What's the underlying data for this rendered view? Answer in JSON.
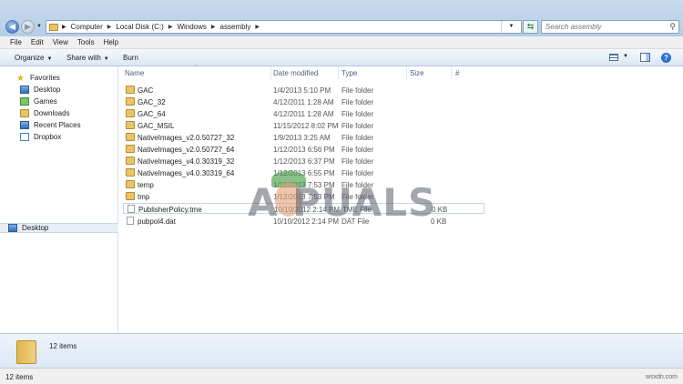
{
  "address": {
    "breadcrumbs": [
      "Computer",
      "Local Disk (C:)",
      "Windows",
      "assembly"
    ]
  },
  "search": {
    "placeholder": "Search assembly"
  },
  "menu": [
    "File",
    "Edit",
    "View",
    "Tools",
    "Help"
  ],
  "toolbar": {
    "organize": "Organize",
    "share": "Share with",
    "burn": "Burn"
  },
  "sidebar": {
    "favorites": "Favorites",
    "items": [
      "Desktop",
      "Games",
      "Downloads",
      "Recent Places",
      "Dropbox"
    ],
    "desktop_root": "Desktop"
  },
  "columns": {
    "name": "Name",
    "date": "Date modified",
    "type": "Type",
    "size": "Size",
    "extra": "#"
  },
  "files": [
    {
      "name": "GAC",
      "date": "1/4/2013 5:10 PM",
      "type": "File folder",
      "size": "",
      "icon": "folder"
    },
    {
      "name": "GAC_32",
      "date": "4/12/2011 1:28 AM",
      "type": "File folder",
      "size": "",
      "icon": "folder"
    },
    {
      "name": "GAC_64",
      "date": "4/12/2011 1:28 AM",
      "type": "File folder",
      "size": "",
      "icon": "folder"
    },
    {
      "name": "GAC_MSIL",
      "date": "11/15/2012 8:02 PM",
      "type": "File folder",
      "size": "",
      "icon": "folder"
    },
    {
      "name": "NativeImages_v2.0.50727_32",
      "date": "1/9/2013 3:25 AM",
      "type": "File folder",
      "size": "",
      "icon": "folder"
    },
    {
      "name": "NativeImages_v2.0.50727_64",
      "date": "1/12/2013 6:56 PM",
      "type": "File folder",
      "size": "",
      "icon": "folder"
    },
    {
      "name": "NativeImages_v4.0.30319_32",
      "date": "1/12/2013 6:37 PM",
      "type": "File folder",
      "size": "",
      "icon": "folder"
    },
    {
      "name": "NativeImages_v4.0.30319_64",
      "date": "1/12/2013 6:55 PM",
      "type": "File folder",
      "size": "",
      "icon": "folder"
    },
    {
      "name": "temp",
      "date": "1/12/2013 7:53 PM",
      "type": "File folder",
      "size": "",
      "icon": "folder"
    },
    {
      "name": "tmp",
      "date": "1/12/2013 7:53 PM",
      "type": "File folder",
      "size": "",
      "icon": "folder"
    },
    {
      "name": "PublisherPolicy.tme",
      "date": "10/10/2012 2:14 PM",
      "type": "TME File",
      "size": "0 KB",
      "icon": "document"
    },
    {
      "name": "pubpol4.dat",
      "date": "10/10/2012 2:14 PM",
      "type": "DAT File",
      "size": "0 KB",
      "icon": "document"
    }
  ],
  "details": {
    "count": "12 items"
  },
  "status": {
    "text": "12 items"
  },
  "watermark": "A  PUALS",
  "site": "wsxdn.com"
}
